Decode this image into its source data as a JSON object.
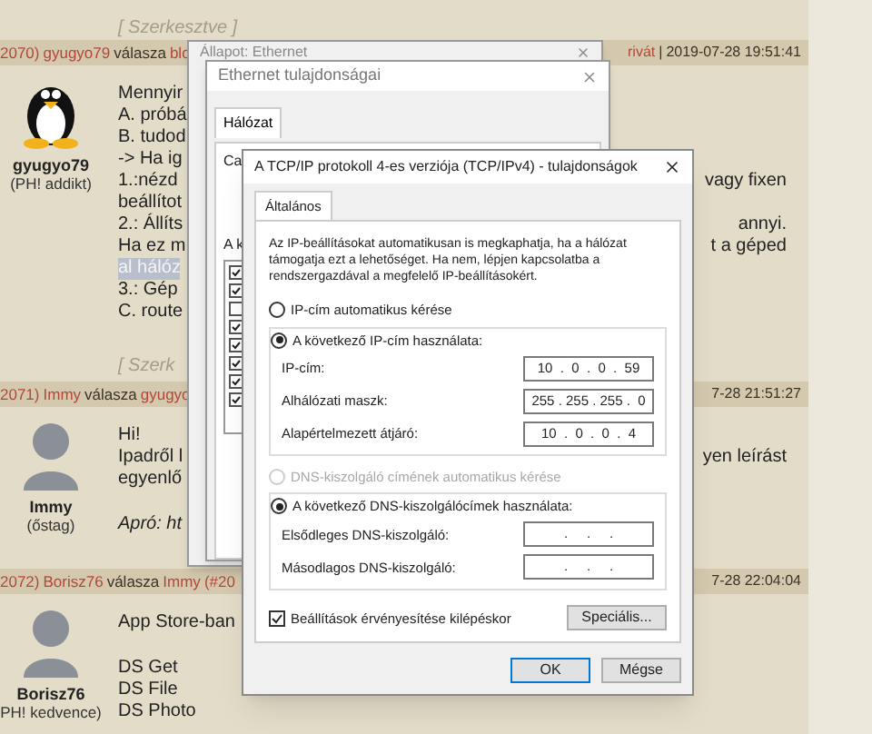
{
  "top_note": "[ Szerkesztve ]",
  "posts": [
    {
      "header_left": [
        {
          "text": "2070)",
          "kind": "link"
        },
        {
          "text": "gyugyo79",
          "kind": "link"
        },
        {
          "text": "válasza",
          "kind": "plain"
        },
        {
          "text": "blo",
          "kind": "link"
        }
      ],
      "header_right": [
        {
          "text": "rivát",
          "kind": "link"
        },
        {
          "text": "|",
          "kind": "plain"
        },
        {
          "text": "2019-07-28 19:51:41",
          "kind": "plain"
        }
      ],
      "kind": "penguin",
      "user": "gyugyo79",
      "rank": "(PH! addikt)",
      "paragraphs": [
        [
          {
            "left": "Mennyir"
          },
          {
            "left": "A. próbá"
          },
          {
            "left": "B. tudod"
          },
          {
            "left": "-> Ha ig"
          },
          {
            "left": "1.:nézd",
            "right": "vagy fixen"
          },
          {
            "left": "beállítot"
          },
          {
            "left": "2.: Állíts",
            "right": "annyi."
          },
          {
            "left": "Ha ez m",
            "right": "t a géped"
          },
          {
            "left": "al hálóz",
            "highlighted": true
          },
          {
            "left": "3.: Gép"
          },
          {
            "left": "C. route"
          }
        ]
      ],
      "edited_note": "[ Szerk"
    },
    {
      "header_left": [
        {
          "text": "2071)",
          "kind": "link"
        },
        {
          "text": "Immy",
          "kind": "link"
        },
        {
          "text": "válasza",
          "kind": "plain"
        },
        {
          "text": "gyugyo",
          "kind": "link"
        }
      ],
      "header_right": [
        {
          "text": "7-28 21:51:27",
          "kind": "plain"
        }
      ],
      "kind": "person",
      "user": "Immy",
      "rank": "(őstag)",
      "paragraphs": [
        [
          {
            "left": "Hi!"
          },
          {
            "left": "Ipadről l",
            "right": "yen leírást"
          },
          {
            "left": "egyenlő"
          }
        ],
        [
          {
            "left": "Apró: ht",
            "italic": true
          }
        ]
      ]
    },
    {
      "header_left": [
        {
          "text": "2072)",
          "kind": "link"
        },
        {
          "text": "Borisz76",
          "kind": "link"
        },
        {
          "text": "válasza",
          "kind": "plain"
        },
        {
          "text": "Immy",
          "kind": "link"
        },
        {
          "text": "(#20",
          "kind": "link"
        }
      ],
      "header_right": [
        {
          "text": "7-28 22:04:04",
          "kind": "plain"
        }
      ],
      "kind": "person",
      "user": "Borisz76",
      "rank": "PH! kedvence)",
      "paragraphs": [
        [
          {
            "left": "App Store-ban"
          }
        ],
        [
          {
            "left": "DS Get"
          },
          {
            "left": "DS File"
          },
          {
            "left": "DS Photo"
          }
        ]
      ]
    }
  ],
  "status_window": {
    "title": "Állapot: Ethernet"
  },
  "properties_window": {
    "title": "Ethernet tulajdonságai",
    "tab": "Hálózat",
    "text_1": "Ca",
    "text_2": "A k",
    "items": [
      {
        "checked": true
      },
      {
        "checked": true
      },
      {
        "checked": false
      },
      {
        "checked": true
      },
      {
        "checked": true
      },
      {
        "checked": true
      },
      {
        "checked": true
      },
      {
        "checked": true
      }
    ]
  },
  "tcp_dialog": {
    "title": "A TCP/IP protokoll 4-es verziója (TCP/IPv4) - tulajdonságok",
    "tab": "Általános",
    "description": "Az IP-beállításokat automatikusan is megkaphatja, ha a hálózat támogatja ezt a lehetőséget. Ha nem, lépjen kapcsolatba a rendszergazdával a megfelelő IP-beállításokért.",
    "ip_auto": {
      "label": "IP-cím automatikus kérése",
      "selected": false,
      "disabled": false
    },
    "ip_manual": {
      "label": "A következő IP-cím használata:",
      "selected": true,
      "disabled": false
    },
    "ip_fields": [
      {
        "label": "IP-cím:",
        "value": "10  .  0  .  0  .  59"
      },
      {
        "label": "Alhálózati maszk:",
        "value": "255 . 255 . 255 .  0"
      },
      {
        "label": "Alapértelmezett átjáró:",
        "value": "10  .  0  .  0  .  4"
      }
    ],
    "dns_auto": {
      "label": "DNS-kiszolgáló címének automatikus kérése",
      "selected": false,
      "disabled": true
    },
    "dns_manual": {
      "label": "A következő DNS-kiszolgálócímek használata:",
      "selected": true,
      "disabled": false
    },
    "dns_fields": [
      {
        "label": "Elsődleges DNS-kiszolgáló:",
        "value": ".     .     ."
      },
      {
        "label": "Másodlagos DNS-kiszolgáló:",
        "value": ".     .     ."
      }
    ],
    "validate": {
      "label": "Beállítások érvényesítése kilépéskor",
      "checked": true
    },
    "advanced_button": "Speciális...",
    "ok_button": "OK",
    "cancel_button": "Mégse"
  }
}
